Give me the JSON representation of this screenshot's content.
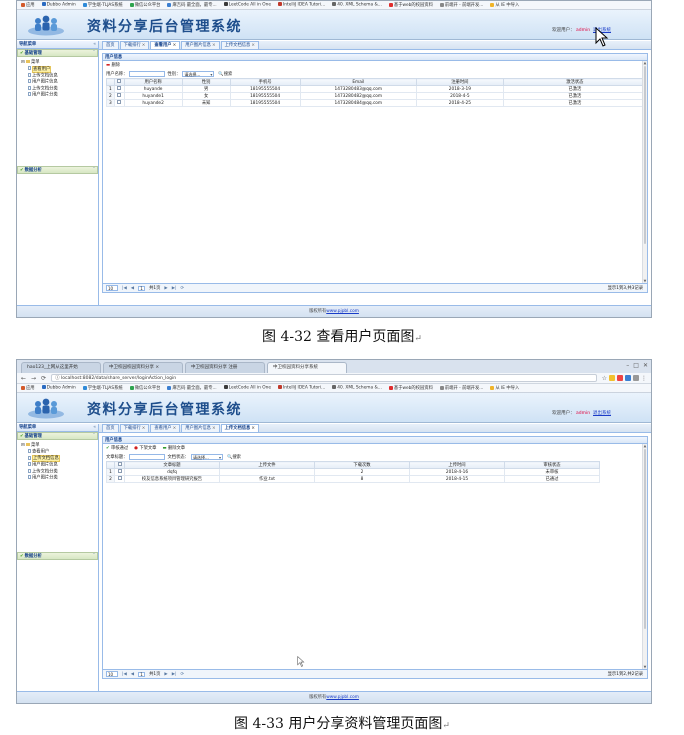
{
  "figures": [
    {
      "browser_tabs": [],
      "url": "",
      "bookmarks": [
        {
          "label": "应用",
          "color": "#d35a2b"
        },
        {
          "label": "Dubbo Admin",
          "color": "#2a6bc2"
        },
        {
          "label": "学生端-TLJAS系统",
          "color": "#2f8ad8"
        },
        {
          "label": "微信公众平台",
          "color": "#2ea44f"
        },
        {
          "label": "麻吉码 最全面，最专...",
          "color": "#3b7fd1"
        },
        {
          "label": "LeetCode All in One",
          "color": "#3a3a3a"
        },
        {
          "label": "IntelliJ IDEA Tutori...",
          "color": "#c0392b"
        },
        {
          "label": "40. XML Schema &...",
          "color": "#666666"
        },
        {
          "label": "基于web的校园资料",
          "color": "#e02d2d"
        },
        {
          "label": "前端开 - 前端开发...",
          "color": "#888888"
        },
        {
          "label": "从 IE 中导入",
          "color": "#f0b429"
        }
      ],
      "header": {
        "title": "资料分享后台管理系统",
        "welcome": "欢迎用户：",
        "user": "admin",
        "logout": "退出系统"
      },
      "left": {
        "nav_title": "导航菜单",
        "collapse": "«",
        "section1": "基础管理",
        "section2": "数据分析",
        "tree_root": "菜单",
        "tree_items": [
          "查看用户",
          "上传文档信息",
          "用户图片信息",
          "上传文档分类",
          "用户图片分类"
        ],
        "selected_index": 0
      },
      "tabs": [
        {
          "label": "首页",
          "closable": false
        },
        {
          "label": "下载排行",
          "closable": true
        },
        {
          "label": "查看用户",
          "closable": true
        },
        {
          "label": "用户图片信息",
          "closable": true
        },
        {
          "label": "上传文档信息",
          "closable": true
        }
      ],
      "active_tab": 2,
      "panel_title": "用户信息",
      "toolbar": [
        {
          "label": "删除",
          "icon": "remove",
          "icon_color": "red"
        }
      ],
      "search": {
        "label1": "用户名称：",
        "label2": "性别：",
        "select": "请选择...",
        "button": "搜索"
      },
      "columns": [
        "用户名称",
        "性别",
        "手机号",
        "Email",
        "注册时间",
        "激活状态"
      ],
      "col_widths": [
        60,
        50,
        72,
        120,
        90,
        150
      ],
      "rows": [
        [
          "huyande",
          "男",
          "18195555504",
          "1473280483@qq.com",
          "2018-3-19",
          "已激活"
        ],
        [
          "huyande1",
          "女",
          "18195555504",
          "1473280482@qq.com",
          "2018-4-5",
          "已激活"
        ],
        [
          "huyande2",
          "未知",
          "18195555504",
          "1473280484@qq.com",
          "2018-4-25",
          "已激活"
        ]
      ],
      "pager": {
        "size": "10",
        "page": "1",
        "total_pages": "共1页",
        "info": "显示1到3,共3记录"
      },
      "footer": {
        "text": "版权所有",
        "link": "www.pjpbl.com"
      },
      "caption": "图 4-32  查看用户页面图"
    },
    {
      "browser_tabs": [
        {
          "label": "hao123_上网从这里开始",
          "active": false
        },
        {
          "label": "中卫校园校园资料分享 ×",
          "active": false
        },
        {
          "label": "中卫校园资料分享 注册",
          "active": false
        },
        {
          "label": "中卫校园资料分享系统",
          "active": true
        }
      ],
      "url": "localhost:8082/data/share_server/loginAction_login",
      "bookmarks": [
        {
          "label": "应用",
          "color": "#d35a2b"
        },
        {
          "label": "Dubbo Admin",
          "color": "#2a6bc2"
        },
        {
          "label": "学生端-TLJAS系统",
          "color": "#2f8ad8"
        },
        {
          "label": "微信公众平台",
          "color": "#2ea44f"
        },
        {
          "label": "麻吉码 最全面，最专...",
          "color": "#3b7fd1"
        },
        {
          "label": "LeetCode All in One",
          "color": "#3a3a3a"
        },
        {
          "label": "IntelliJ IDEA Tutori...",
          "color": "#c0392b"
        },
        {
          "label": "40. XML Schema &...",
          "color": "#666666"
        },
        {
          "label": "基于web的校园资料",
          "color": "#e02d2d"
        },
        {
          "label": "前端开 - 前端开发...",
          "color": "#888888"
        },
        {
          "label": "从 IE 中导入",
          "color": "#f0b429"
        }
      ],
      "header": {
        "title": "资料分享后台管理系统",
        "welcome": "欢迎用户：",
        "user": "admin",
        "logout": "退出系统"
      },
      "left": {
        "nav_title": "导航菜单",
        "collapse": "«",
        "section1": "基础管理",
        "section2": "数据分析",
        "tree_root": "菜单",
        "tree_items": [
          "查看用户",
          "上传文档信息",
          "用户图片信息",
          "上传文档分类",
          "用户图片分类"
        ],
        "selected_index": 1
      },
      "tabs": [
        {
          "label": "首页",
          "closable": false
        },
        {
          "label": "下载排行",
          "closable": true
        },
        {
          "label": "查看用户",
          "closable": true
        },
        {
          "label": "用户图片信息",
          "closable": true
        },
        {
          "label": "上传文档信息",
          "closable": true
        }
      ],
      "active_tab": 4,
      "panel_title": "用户信息",
      "toolbar": [
        {
          "label": "审核通过",
          "icon": "check",
          "icon_color": "green"
        },
        {
          "label": "下架文章",
          "icon": "stop",
          "icon_color": "red"
        },
        {
          "label": "删除文章",
          "icon": "remove",
          "icon_color": "green"
        }
      ],
      "search": {
        "label1": "文章标题：",
        "label2": "文档状态：",
        "select": "请选择...",
        "button": "搜索"
      },
      "columns": [
        "文章标题",
        "上传文件",
        "下载次数",
        "上传时间",
        "审核状态"
      ],
      "col_widths": [
        95,
        95,
        95,
        95,
        95
      ],
      "rows": [
        [
          "dqfq",
          "",
          "2",
          "2018-4-16",
          "未审核"
        ],
        [
          "校友信息系统项目管理研究报告",
          "作业.txt",
          "8",
          "2018-4-15",
          "已通过"
        ]
      ],
      "pager": {
        "size": "10",
        "page": "1",
        "total_pages": "共1页",
        "info": "显示1到2,共2记录"
      },
      "footer": {
        "text": "版权所有",
        "link": "www.pjpbl.com"
      },
      "caption": "图 4-33  用户分享资料管理页面图"
    }
  ]
}
